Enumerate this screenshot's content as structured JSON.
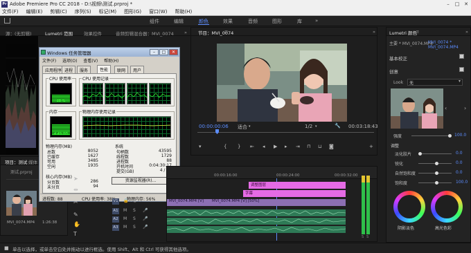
{
  "window": {
    "title": "Adobe Premiere Pro CC 2018 - D:\\视频\\测试.prproj *",
    "minimize": "–",
    "maximize": "□",
    "close": "✕"
  },
  "menu": [
    "文件(F)",
    "编辑(E)",
    "剪辑(C)",
    "序列(S)",
    "标记(M)",
    "图形(G)",
    "窗口(W)",
    "帮助(H)"
  ],
  "workspace_tabs": {
    "items": [
      "组件",
      "编辑",
      "颜色",
      "效果",
      "音频",
      "图形",
      "库"
    ],
    "active": "颜色",
    "more": "»"
  },
  "left_panel": {
    "tabs": [
      "源：(无剪辑)",
      "Lumetri 范围",
      "效果控件",
      "音频剪辑混合器：MVI_0074"
    ],
    "more": "»"
  },
  "project": {
    "tabs": [
      "项目：测试",
      "媒体"
    ],
    "file": "测试.prproj",
    "clip_name": "MVI_0074.MP4",
    "clip_duration": "1:26:38"
  },
  "task_manager": {
    "title": "Windows 任务管理器",
    "menu": [
      "文件(F)",
      "选项(O)",
      "查看(V)",
      "帮助(H)"
    ],
    "tabs": [
      "应用程序",
      "进程",
      "服务",
      "性能",
      "联网",
      "用户"
    ],
    "active_tab": "性能",
    "groups": {
      "cpu_usage": "CPU 使用率",
      "cpu_history": "CPU 使用记录",
      "memory": "内存",
      "memory_history": "物理内存使用记录"
    },
    "cpu_percent_label": "38 %",
    "cpu_fraction": 0.38,
    "memory_label": "4.49 GB",
    "memory_fraction": 0.56,
    "physical_memory": {
      "heading": "物理内存(MB)",
      "rows": [
        {
          "k": "总数",
          "v": "8052"
        },
        {
          "k": "已缓存",
          "v": "1627"
        },
        {
          "k": "可用",
          "v": "3485"
        },
        {
          "k": "空闲",
          "v": "1935"
        }
      ]
    },
    "system": {
      "heading": "系统",
      "rows": [
        {
          "k": "句柄数",
          "v": "43595"
        },
        {
          "k": "线程数",
          "v": "1729"
        },
        {
          "k": "进程数",
          "v": "88"
        },
        {
          "k": "开机时间",
          "v": "0:04:30:17"
        },
        {
          "k": "提交(GB)",
          "v": "4 / 15"
        }
      ]
    },
    "kernel_memory": {
      "heading": "核心内存(MB)",
      "rows": [
        {
          "k": "分页数",
          "v": "286"
        },
        {
          "k": "未分页",
          "v": "94"
        }
      ]
    },
    "resource_button": "资源监视器(R)...",
    "status": {
      "processes": "进程数: 88",
      "cpu": "CPU 使用率: 38%",
      "memory": "物理内存: 56%"
    },
    "title_buttons": {
      "minimize": "–",
      "maximize": "□",
      "close": "✕"
    }
  },
  "program_monitor": {
    "tab": "节目：MVI_0074",
    "menu_icon": "≡",
    "more": "»",
    "current_time": "00:00:00:06",
    "fit": "适合",
    "resolution": "1/2",
    "duration": "00:03:18:43"
  },
  "timeline": {
    "ruler_labels": [
      "00:00:16:00",
      "00:00:24:00",
      "00:00:32:00"
    ],
    "clips": [
      {
        "label": "MVI_0074.MP4 [V]",
        "color": "#d75ed7"
      },
      {
        "label": "调整图层",
        "color": "#e56be5"
      },
      {
        "label": "字幕",
        "color": "#e56be5"
      },
      {
        "label": "MVI_0074.MP4 [V] [50%]",
        "color": "#8c6fb3"
      },
      {
        "label": "MVI_0074.MP4 [V]",
        "color": "#8c6fb3"
      }
    ],
    "tracks": [
      "V1",
      "A1",
      "A2",
      "A3"
    ]
  },
  "lumetri": {
    "tab": "Lumetri 颜色",
    "more": "»",
    "source": "主要 * MVI_0074.MP4",
    "sequence": "MVI_0074 * MVI_0074.MP4",
    "basic_correction": "基本校正",
    "creative": "创意",
    "look_label": "Look",
    "look_value": "无",
    "intensity": {
      "label": "强度",
      "value": "100.0"
    },
    "adjust_heading": "调整",
    "sliders": [
      {
        "label": "淡化胶片",
        "value": "0.0",
        "position": 0.0
      },
      {
        "label": "锐化",
        "value": "0.0",
        "position": 0.5
      },
      {
        "label": "自然饱和度",
        "value": "0.0",
        "position": 0.5
      },
      {
        "label": "饱和度",
        "value": "100.0",
        "position": 0.5
      }
    ],
    "wheels": [
      "阴影淡色",
      "高光色彩"
    ]
  },
  "status_bar": "单击以选择，或单击空白处并拖动以进行框选。使用 Shift、Alt 和 Ctrl 可获得其他选项。",
  "colors": {
    "accent": "#5c8dff",
    "clip_pink": "#e56be5",
    "clip_purple": "#8c6fb3"
  }
}
